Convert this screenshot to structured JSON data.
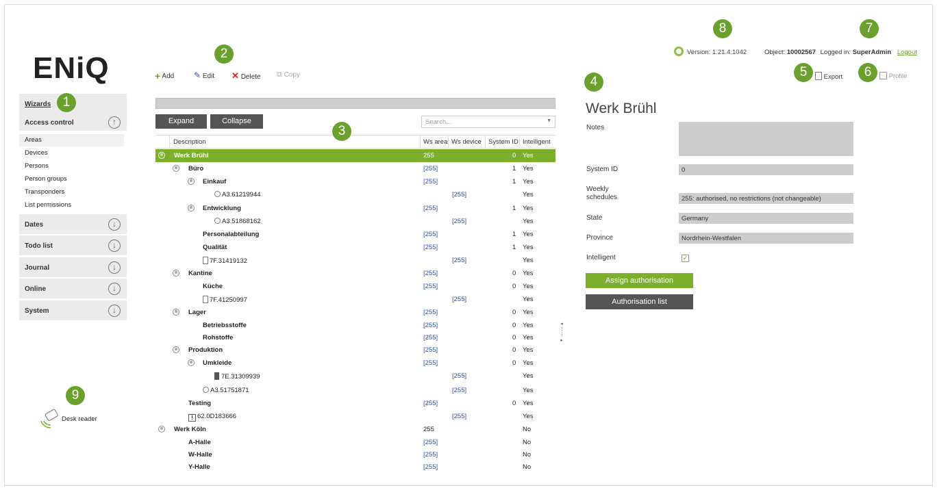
{
  "logo": "ENiQ",
  "sidebar": {
    "wizards": "Wizards",
    "sections": [
      {
        "label": "Access control",
        "expanded": true
      },
      {
        "label": "Dates"
      },
      {
        "label": "Todo list"
      },
      {
        "label": "Journal"
      },
      {
        "label": "Online"
      },
      {
        "label": "System"
      }
    ],
    "items": [
      "Areas",
      "Devices",
      "Persons",
      "Person groups",
      "Transponders",
      "List permissions"
    ],
    "desk_reader": "Desk reader"
  },
  "toolbar": {
    "add": "Add",
    "edit": "Edit",
    "delete": "Delete",
    "copy": "Copy"
  },
  "tree": {
    "expand": "Expand",
    "collapse": "Collapse",
    "search_placeholder": "Search...",
    "columns": [
      "Description",
      "Ws area",
      "Ws device",
      "System ID",
      "Intelligent"
    ],
    "rows": [
      {
        "desc": "Werk Brühl",
        "ws_area": "255",
        "ws_device": "",
        "system_id": "0",
        "intelligent": "Yes"
      },
      {
        "desc": "Büro",
        "ws_area": "[255]",
        "ws_device": "",
        "system_id": "1",
        "intelligent": "Yes"
      },
      {
        "desc": "Einkauf",
        "ws_area": "[255]",
        "ws_device": "",
        "system_id": "1",
        "intelligent": "Yes"
      },
      {
        "desc": "A3.61219944",
        "ws_area": "",
        "ws_device": "[255]",
        "system_id": "",
        "intelligent": "Yes"
      },
      {
        "desc": "Entwicklung",
        "ws_area": "[255]",
        "ws_device": "",
        "system_id": "1",
        "intelligent": "Yes"
      },
      {
        "desc": "A3.51868162",
        "ws_area": "",
        "ws_device": "[255]",
        "system_id": "",
        "intelligent": "Yes"
      },
      {
        "desc": "Personalabteilung",
        "ws_area": "[255]",
        "ws_device": "",
        "system_id": "1",
        "intelligent": "Yes"
      },
      {
        "desc": "Qualität",
        "ws_area": "[255]",
        "ws_device": "",
        "system_id": "1",
        "intelligent": "Yes"
      },
      {
        "desc": "7F.31419132",
        "ws_area": "",
        "ws_device": "[255]",
        "system_id": "",
        "intelligent": "Yes"
      },
      {
        "desc": "Kantine",
        "ws_area": "[255]",
        "ws_device": "",
        "system_id": "0",
        "intelligent": "Yes"
      },
      {
        "desc": "Küche",
        "ws_area": "[255]",
        "ws_device": "",
        "system_id": "0",
        "intelligent": "Yes"
      },
      {
        "desc": "7F.41250997",
        "ws_area": "",
        "ws_device": "[255]",
        "system_id": "",
        "intelligent": "Yes"
      },
      {
        "desc": "Lager",
        "ws_area": "[255]",
        "ws_device": "",
        "system_id": "0",
        "intelligent": "Yes"
      },
      {
        "desc": "Betriebsstoffe",
        "ws_area": "[255]",
        "ws_device": "",
        "system_id": "0",
        "intelligent": "Yes"
      },
      {
        "desc": "Rohstoffe",
        "ws_area": "[255]",
        "ws_device": "",
        "system_id": "0",
        "intelligent": "Yes"
      },
      {
        "desc": "Produktion",
        "ws_area": "[255]",
        "ws_device": "",
        "system_id": "0",
        "intelligent": "Yes"
      },
      {
        "desc": "Umkleide",
        "ws_area": "[255]",
        "ws_device": "",
        "system_id": "0",
        "intelligent": "Yes"
      },
      {
        "desc": "7E.31309939",
        "ws_area": "",
        "ws_device": "[255]",
        "system_id": "",
        "intelligent": "Yes"
      },
      {
        "desc": "A3.51751871",
        "ws_area": "",
        "ws_device": "[255]",
        "system_id": "",
        "intelligent": "Yes"
      },
      {
        "desc": "Testing",
        "ws_area": "[255]",
        "ws_device": "",
        "system_id": "0",
        "intelligent": "Yes"
      },
      {
        "desc": "62.0D183666",
        "ws_area": "",
        "ws_device": "[255]",
        "system_id": "",
        "intelligent": "Yes"
      },
      {
        "desc": "Werk Köln",
        "ws_area": "255",
        "ws_device": "",
        "system_id": "",
        "intelligent": "No"
      },
      {
        "desc": "A-Halle",
        "ws_area": "[255]",
        "ws_device": "",
        "system_id": "",
        "intelligent": "No"
      },
      {
        "desc": "W-Halle",
        "ws_area": "[255]",
        "ws_device": "",
        "system_id": "",
        "intelligent": "No"
      },
      {
        "desc": "Y-Halle",
        "ws_area": "[255]",
        "ws_device": "",
        "system_id": "",
        "intelligent": "No"
      }
    ]
  },
  "header": {
    "version": "Version: 1.21.4.1042",
    "object_label": "Object:",
    "object_value": "10002567",
    "logged_label": "Logged in:",
    "logged_user": "SuperAdmin",
    "logout": "Logout",
    "export": "Export",
    "profile": "Profile"
  },
  "detail": {
    "title": "Werk Brühl",
    "notes_label": "Notes",
    "notes_value": "",
    "system_id_label": "System ID",
    "system_id_value": "0",
    "weekly_label_1": "Weekly",
    "weekly_label_2": "schedules",
    "weekly_value": "255: authorised, no restrictions (not changeable)",
    "state_label": "State",
    "state_value": "Germany",
    "province_label": "Province",
    "province_value": "Nordrhein-Westfalen",
    "intelligent_label": "Intelligent",
    "intelligent_checked": true,
    "assign_btn": "Assign authorisation",
    "auth_list_btn": "Authorisation list"
  },
  "badges": [
    "1",
    "2",
    "3",
    "4",
    "5",
    "6",
    "7",
    "8",
    "9"
  ],
  "colors": {
    "accent": "#7cb02c",
    "badge": "#6aa12c",
    "dark_button": "#555555",
    "link": "#2c4fa3"
  }
}
